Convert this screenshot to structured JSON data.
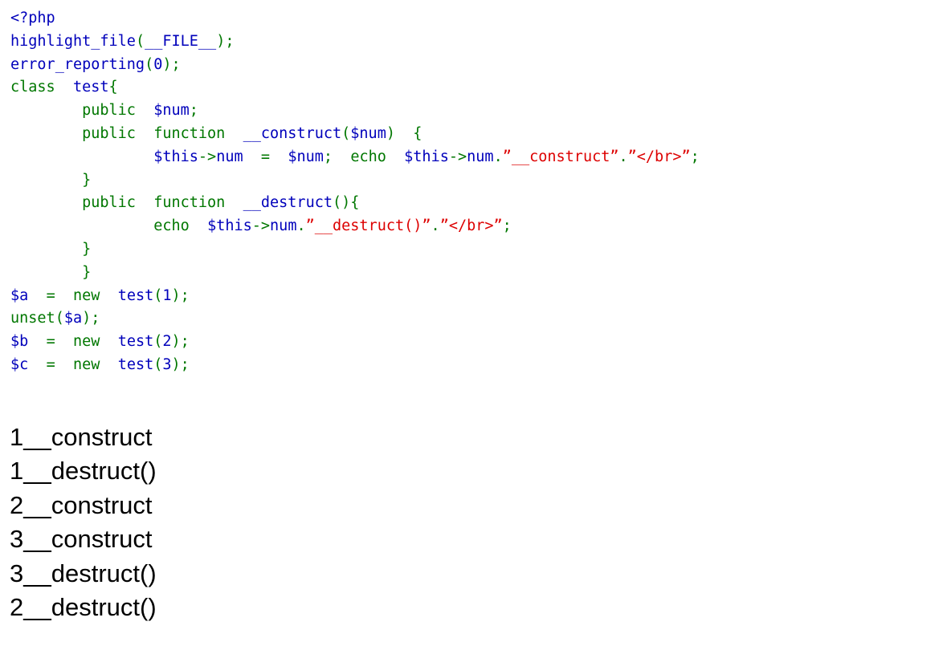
{
  "page": {
    "background_color": "#ffffff",
    "title": "PHP highlight_file source listing with script output"
  },
  "syntax_colors": {
    "default": "#0000BB",
    "keyword": "#007700",
    "string": "#DD0000",
    "comment": "#FF8000",
    "output_text": "#000000"
  },
  "code": {
    "language": "php",
    "lines": [
      {
        "id": "line-1",
        "tokens": [
          {
            "t": "<?php",
            "c": "default"
          }
        ]
      },
      {
        "id": "line-2",
        "tokens": [
          {
            "t": "highlight_file",
            "c": "default"
          },
          {
            "t": "(",
            "c": "keyword"
          },
          {
            "t": "__FILE__",
            "c": "default"
          },
          {
            "t": ")",
            "c": "keyword"
          },
          {
            "t": ";",
            "c": "keyword"
          }
        ]
      },
      {
        "id": "line-3",
        "tokens": [
          {
            "t": "error_reporting",
            "c": "default"
          },
          {
            "t": "(",
            "c": "keyword"
          },
          {
            "t": "0",
            "c": "default"
          },
          {
            "t": ")",
            "c": "keyword"
          },
          {
            "t": ";",
            "c": "keyword"
          }
        ]
      },
      {
        "id": "line-4",
        "tokens": [
          {
            "t": "class",
            "c": "keyword"
          },
          {
            "t": "  ",
            "c": "keyword"
          },
          {
            "t": "test",
            "c": "default"
          },
          {
            "t": "{",
            "c": "keyword"
          }
        ]
      },
      {
        "id": "line-5",
        "tokens": [
          {
            "t": "        ",
            "c": "keyword"
          },
          {
            "t": "public",
            "c": "keyword"
          },
          {
            "t": "  ",
            "c": "keyword"
          },
          {
            "t": "$num",
            "c": "default"
          },
          {
            "t": ";",
            "c": "keyword"
          }
        ]
      },
      {
        "id": "line-6",
        "tokens": [
          {
            "t": "        ",
            "c": "keyword"
          },
          {
            "t": "public",
            "c": "keyword"
          },
          {
            "t": "  ",
            "c": "keyword"
          },
          {
            "t": "function",
            "c": "keyword"
          },
          {
            "t": "  ",
            "c": "keyword"
          },
          {
            "t": "__construct",
            "c": "default"
          },
          {
            "t": "(",
            "c": "keyword"
          },
          {
            "t": "$num",
            "c": "default"
          },
          {
            "t": ")",
            "c": "keyword"
          },
          {
            "t": "  ",
            "c": "keyword"
          },
          {
            "t": "{",
            "c": "keyword"
          }
        ]
      },
      {
        "id": "line-7",
        "tokens": [
          {
            "t": "                ",
            "c": "keyword"
          },
          {
            "t": "$this",
            "c": "default"
          },
          {
            "t": "->",
            "c": "keyword"
          },
          {
            "t": "num",
            "c": "default"
          },
          {
            "t": "  ",
            "c": "keyword"
          },
          {
            "t": "=",
            "c": "keyword"
          },
          {
            "t": "  ",
            "c": "keyword"
          },
          {
            "t": "$num",
            "c": "default"
          },
          {
            "t": ";",
            "c": "keyword"
          },
          {
            "t": "  ",
            "c": "keyword"
          },
          {
            "t": "echo",
            "c": "keyword"
          },
          {
            "t": "  ",
            "c": "keyword"
          },
          {
            "t": "$this",
            "c": "default"
          },
          {
            "t": "->",
            "c": "keyword"
          },
          {
            "t": "num",
            "c": "default"
          },
          {
            "t": ".",
            "c": "keyword"
          },
          {
            "t": "”__construct”",
            "c": "string"
          },
          {
            "t": ".",
            "c": "keyword"
          },
          {
            "t": "”</br>”",
            "c": "string"
          },
          {
            "t": ";",
            "c": "keyword"
          }
        ]
      },
      {
        "id": "line-8",
        "tokens": [
          {
            "t": "        ",
            "c": "keyword"
          },
          {
            "t": "}",
            "c": "keyword"
          }
        ]
      },
      {
        "id": "line-9",
        "tokens": [
          {
            "t": "        ",
            "c": "keyword"
          },
          {
            "t": "public",
            "c": "keyword"
          },
          {
            "t": "  ",
            "c": "keyword"
          },
          {
            "t": "function",
            "c": "keyword"
          },
          {
            "t": "  ",
            "c": "keyword"
          },
          {
            "t": "__destruct",
            "c": "default"
          },
          {
            "t": "(",
            "c": "keyword"
          },
          {
            "t": ")",
            "c": "keyword"
          },
          {
            "t": "{",
            "c": "keyword"
          }
        ]
      },
      {
        "id": "line-10",
        "tokens": [
          {
            "t": "                ",
            "c": "keyword"
          },
          {
            "t": "echo",
            "c": "keyword"
          },
          {
            "t": "  ",
            "c": "keyword"
          },
          {
            "t": "$this",
            "c": "default"
          },
          {
            "t": "->",
            "c": "keyword"
          },
          {
            "t": "num",
            "c": "default"
          },
          {
            "t": ".",
            "c": "keyword"
          },
          {
            "t": "”__destruct()”",
            "c": "string"
          },
          {
            "t": ".",
            "c": "keyword"
          },
          {
            "t": "”</br>”",
            "c": "string"
          },
          {
            "t": ";",
            "c": "keyword"
          }
        ]
      },
      {
        "id": "line-11",
        "tokens": [
          {
            "t": "        ",
            "c": "keyword"
          },
          {
            "t": "}",
            "c": "keyword"
          }
        ]
      },
      {
        "id": "line-12",
        "tokens": [
          {
            "t": "        ",
            "c": "keyword"
          },
          {
            "t": "}",
            "c": "keyword"
          }
        ]
      },
      {
        "id": "line-13",
        "tokens": [
          {
            "t": "$a",
            "c": "default"
          },
          {
            "t": "  ",
            "c": "keyword"
          },
          {
            "t": "=",
            "c": "keyword"
          },
          {
            "t": "  ",
            "c": "keyword"
          },
          {
            "t": "new",
            "c": "keyword"
          },
          {
            "t": "  ",
            "c": "keyword"
          },
          {
            "t": "test",
            "c": "default"
          },
          {
            "t": "(",
            "c": "keyword"
          },
          {
            "t": "1",
            "c": "default"
          },
          {
            "t": ")",
            "c": "keyword"
          },
          {
            "t": ";",
            "c": "keyword"
          }
        ]
      },
      {
        "id": "line-14",
        "tokens": [
          {
            "t": "unset",
            "c": "keyword"
          },
          {
            "t": "(",
            "c": "keyword"
          },
          {
            "t": "$a",
            "c": "default"
          },
          {
            "t": ")",
            "c": "keyword"
          },
          {
            "t": ";",
            "c": "keyword"
          }
        ]
      },
      {
        "id": "line-15",
        "tokens": [
          {
            "t": "$b",
            "c": "default"
          },
          {
            "t": "  ",
            "c": "keyword"
          },
          {
            "t": "=",
            "c": "keyword"
          },
          {
            "t": "  ",
            "c": "keyword"
          },
          {
            "t": "new",
            "c": "keyword"
          },
          {
            "t": "  ",
            "c": "keyword"
          },
          {
            "t": "test",
            "c": "default"
          },
          {
            "t": "(",
            "c": "keyword"
          },
          {
            "t": "2",
            "c": "default"
          },
          {
            "t": ")",
            "c": "keyword"
          },
          {
            "t": ";",
            "c": "keyword"
          }
        ]
      },
      {
        "id": "line-16",
        "tokens": [
          {
            "t": "$c",
            "c": "default"
          },
          {
            "t": "  ",
            "c": "keyword"
          },
          {
            "t": "=",
            "c": "keyword"
          },
          {
            "t": "  ",
            "c": "keyword"
          },
          {
            "t": "new",
            "c": "keyword"
          },
          {
            "t": "  ",
            "c": "keyword"
          },
          {
            "t": "test",
            "c": "default"
          },
          {
            "t": "(",
            "c": "keyword"
          },
          {
            "t": "3",
            "c": "default"
          },
          {
            "t": ")",
            "c": "keyword"
          },
          {
            "t": ";",
            "c": "keyword"
          }
        ]
      }
    ]
  },
  "output": {
    "lines": [
      "1__construct",
      "1__destruct()",
      "2__construct",
      "3__construct",
      "3__destruct()",
      "2__destruct()"
    ]
  }
}
